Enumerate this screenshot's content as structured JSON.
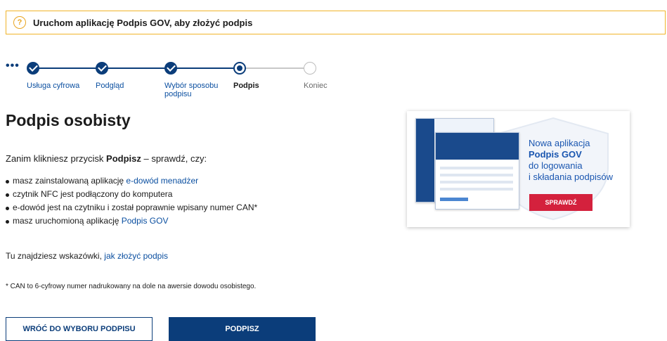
{
  "alert": {
    "icon": "question-circle-icon",
    "text": "Uruchom aplikację Podpis GOV, aby złożyć podpis"
  },
  "stepper": {
    "more": "•••",
    "steps": [
      {
        "label": "Usługa cyfrowa",
        "state": "done"
      },
      {
        "label": "Podgląd",
        "state": "done"
      },
      {
        "label": "Wybór sposobu podpisu",
        "state": "done"
      },
      {
        "label": "Podpis",
        "state": "current"
      },
      {
        "label": "Koniec",
        "state": "future"
      }
    ]
  },
  "main": {
    "title": "Podpis osobisty",
    "intro_prefix": "Zanim klikniesz przycisk ",
    "intro_bold": "Podpisz",
    "intro_suffix": " – sprawdź, czy:",
    "checklist": {
      "item1_prefix": "masz zainstalowaną aplikację ",
      "item1_link": "e-dowód menadżer",
      "item2": "czytnik NFC jest podłączony do komputera",
      "item3": "e-dowód jest na czytniku i został poprawnie wpisany numer CAN*",
      "item4_prefix": "masz uruchomioną aplikację ",
      "item4_link": "Podpis GOV"
    },
    "hint_prefix": "Tu znajdziesz wskazówki, ",
    "hint_link": "jak złożyć podpis",
    "footnote": "* CAN to 6-cyfrowy numer nadrukowany na dole na awersie dowodu osobistego."
  },
  "buttons": {
    "back": "WRÓĆ DO WYBORU PODPISU",
    "sign": "PODPISZ"
  },
  "promo": {
    "line1": "Nowa aplikacja",
    "line2": "Podpis GOV",
    "line3": "do logowania",
    "line4": "i składania podpisów",
    "button": "SPRAWDŹ"
  },
  "colors": {
    "primary": "#0b3d7a",
    "link": "#0b4fa0",
    "alert_border": "#f0b429",
    "promo_button": "#d4213d"
  }
}
